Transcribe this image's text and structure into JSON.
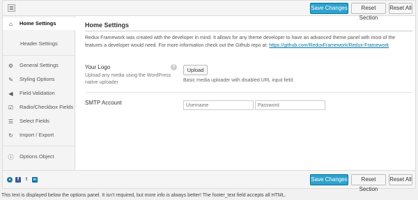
{
  "toolbar": {
    "save_label": "Save Changes",
    "reset_section_label": "Reset Section",
    "reset_all_label": "Reset All"
  },
  "sidebar": {
    "items": [
      {
        "label": "Home Settings",
        "icon": "home-icon",
        "active": true
      },
      {
        "label": "Header Settings",
        "icon": "",
        "active": false
      },
      {
        "label": "General Settings",
        "icon": "cogs-icon",
        "active": false
      },
      {
        "label": "Styling Options",
        "icon": "paint-icon",
        "active": false
      },
      {
        "label": "Field Validation",
        "icon": "megaphone-icon",
        "active": false
      },
      {
        "label": "Radio/Checkbox Fields",
        "icon": "checkbox-icon",
        "active": false
      },
      {
        "label": "Select Fields",
        "icon": "list-icon",
        "active": false
      },
      {
        "label": "Import / Export",
        "icon": "refresh-icon",
        "active": false
      },
      {
        "label": "Options Object",
        "icon": "info-icon",
        "active": false
      }
    ]
  },
  "main": {
    "title": "Home Settings",
    "intro": "Redux Framework was created with the developer in mind. It allows for any theme developer to have an advanced theme panel with most of the features a developer would need. For more information check out the Github repo at: ",
    "intro_link": "https://github.com/ReduxFramework/Redux-Framework",
    "logo_field": {
      "title": "Your Logo",
      "description": "Upload any media using the WordPress native uploader",
      "button_label": "Upload",
      "field_description": "Basic media uploader with disabled URL input field."
    },
    "smtp_field": {
      "title": "SMTP Account",
      "username_placeholder": "Username",
      "password_placeholder": "Password"
    }
  },
  "footer_text": "This text is displayed below the options panel. It isn't required, but more info is always better! The footer_text field accepts all HTML."
}
